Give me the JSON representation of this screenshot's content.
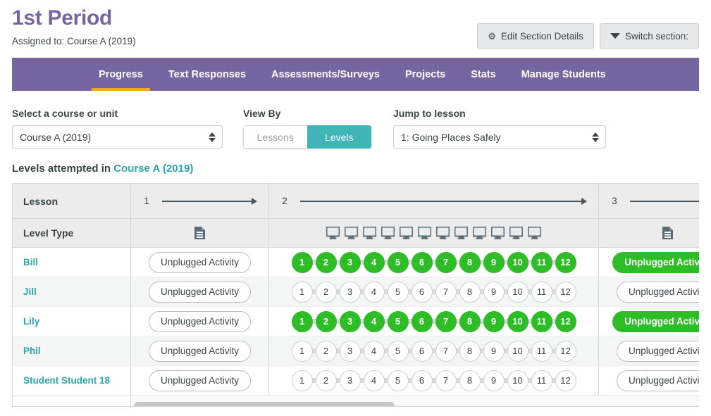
{
  "header": {
    "title": "1st Period",
    "assigned_to": "Assigned to: Course A (2019)",
    "edit_button": "Edit Section Details",
    "switch_button": "Switch section:",
    "gear_icon": "gear-icon",
    "caret_icon": "chevron-down-icon"
  },
  "nav": {
    "items": [
      {
        "label": "Progress",
        "active": true
      },
      {
        "label": "Text Responses",
        "active": false
      },
      {
        "label": "Assessments/Surveys",
        "active": false
      },
      {
        "label": "Projects",
        "active": false
      },
      {
        "label": "Stats",
        "active": false
      },
      {
        "label": "Manage Students",
        "active": false
      }
    ],
    "bar_color": "#7665a0",
    "active_underline_color": "#f5a623"
  },
  "filters": {
    "course_label": "Select a course or unit",
    "course_value": "Course A (2019)",
    "viewby_label": "View By",
    "viewby_options": [
      "Lessons",
      "Levels"
    ],
    "viewby_selected": "Levels",
    "viewby_active_color": "#40b5b8",
    "jump_label": "Jump to lesson",
    "jump_value": "1: Going Places Safely"
  },
  "table": {
    "title_prefix": "Levels attempted in ",
    "title_course": "Course A (2019)",
    "title_course_color": "#2fa4ad",
    "row_header_lesson": "Lesson",
    "row_header_level_type": "Level Type",
    "lessons": [
      {
        "number": "1",
        "level_count": 1,
        "level_types": [
          "document-icon"
        ]
      },
      {
        "number": "2",
        "level_count": 12,
        "level_types": [
          "monitor-icon",
          "monitor-icon",
          "monitor-icon",
          "monitor-icon",
          "monitor-icon",
          "monitor-icon",
          "monitor-icon",
          "monitor-icon",
          "monitor-icon",
          "monitor-icon",
          "monitor-icon",
          "monitor-icon"
        ]
      },
      {
        "number": "3",
        "level_count": 1,
        "level_types": [
          "document-icon"
        ]
      }
    ],
    "unplugged_label": "Unplugged Activity",
    "level_numbers": [
      "1",
      "2",
      "3",
      "4",
      "5",
      "6",
      "7",
      "8",
      "9",
      "10",
      "11",
      "12"
    ],
    "completed_color": "#2ebd27",
    "students": [
      {
        "name": "Bill",
        "lesson1_done": false,
        "lesson2_done": true,
        "lesson3_done": true
      },
      {
        "name": "Jill",
        "lesson1_done": false,
        "lesson2_done": false,
        "lesson3_done": false
      },
      {
        "name": "Lily",
        "lesson1_done": false,
        "lesson2_done": true,
        "lesson3_done": true
      },
      {
        "name": "Phil",
        "lesson1_done": false,
        "lesson2_done": false,
        "lesson3_done": false
      },
      {
        "name": "Student Student 18",
        "lesson1_done": false,
        "lesson2_done": false,
        "lesson3_done": false
      }
    ],
    "scrollbar": "horizontal-scrollbar"
  }
}
